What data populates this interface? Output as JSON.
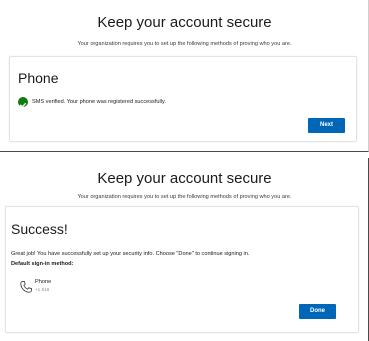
{
  "top": {
    "title": "Keep your account secure",
    "subtitle": "Your organization requires you to set up the following methods of proving who you are.",
    "card_heading": "Phone",
    "status_message": "SMS verified. Your phone was registered successfully.",
    "next_label": "Next"
  },
  "bottom": {
    "title": "Keep your account secure",
    "subtitle": "Your organization requires you to set up the following methods of proving who you are.",
    "card_heading": "Success!",
    "message": "Great job! You have successfully set up your security info. Choose \"Done\" to continue signing in.",
    "default_method_label": "Default sign-in method:",
    "method_name": "Phone",
    "method_value": "+1 618",
    "done_label": "Done"
  },
  "colors": {
    "accent": "#0067b8",
    "success": "#107c10"
  },
  "icons": {
    "success": "check-circle-icon",
    "phone": "phone-icon"
  }
}
